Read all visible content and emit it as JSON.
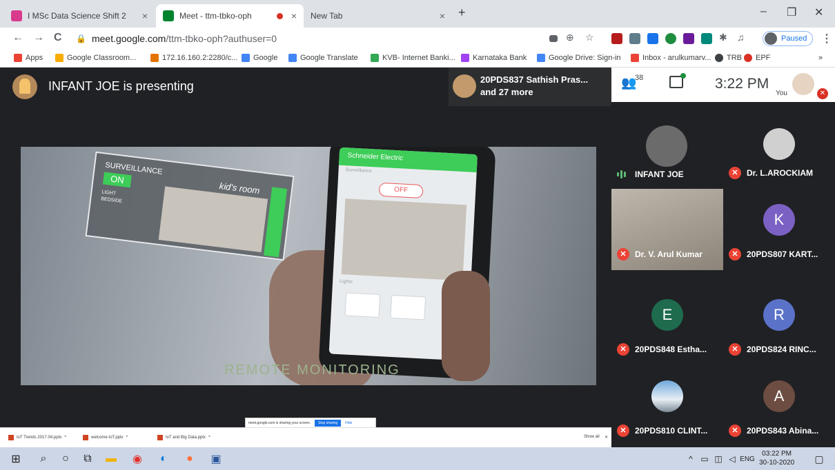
{
  "browser": {
    "tabs": [
      {
        "title": "I MSc Data Science Shift 2",
        "close": "×"
      },
      {
        "title": "Meet - ttm-tbko-oph",
        "close": "×"
      },
      {
        "title": "New Tab",
        "close": "×"
      }
    ],
    "new_tab": "+",
    "window_controls": {
      "minimize": "–",
      "restore": "❐",
      "close": "✕"
    },
    "nav": {
      "back": "←",
      "forward": "→",
      "reload": "C"
    },
    "url_host": "meet.google.com",
    "url_path": "/ttm-tbko-oph?authuser=0",
    "profile_status": "Paused",
    "bookmarks": [
      {
        "label": "Apps",
        "color": "#ea4335"
      },
      {
        "label": "Google Classroom...",
        "color": "#f9ab00"
      },
      {
        "label": "172.16.160.2:2280/c...",
        "color": "#e37400"
      },
      {
        "label": "Google",
        "color": "#4285f4"
      },
      {
        "label": "Google Translate",
        "color": "#4285f4"
      },
      {
        "label": "KVB- Internet Banki...",
        "color": "#34a853"
      },
      {
        "label": "Karnataka Bank",
        "color": "#a142f4"
      },
      {
        "label": "Google Drive: Sign-in",
        "color": "#4285f4"
      },
      {
        "label": "Inbox - arulkumarv...",
        "color": "#ea4335"
      },
      {
        "label": "TRB",
        "color": "#3c4043"
      },
      {
        "label": "EPF",
        "color": "#d93025"
      }
    ],
    "bookmarks_more": "»"
  },
  "meet": {
    "presenting_text": "INFANT JOE is presenting",
    "joined_line1": "20PDS837 Sathish Pras...",
    "joined_line2": "and 27 more",
    "people_count": "38",
    "time": "3:22 PM",
    "you_label": "You",
    "participants": [
      {
        "name": "INFANT JOE",
        "type": "photo",
        "speaking": true
      },
      {
        "name": "Dr. L.AROCKIAM",
        "type": "photo",
        "muted": true
      },
      {
        "name": "Dr. V. Arul Kumar",
        "type": "video",
        "muted": true
      },
      {
        "name": "20PDS807 KART...",
        "initial": "K",
        "color": "#7b61c4",
        "muted": true
      },
      {
        "name": "20PDS848 Estha...",
        "initial": "E",
        "color": "#1e6b4e",
        "muted": true
      },
      {
        "name": "20PDS824 RINC...",
        "initial": "R",
        "color": "#5a72c8",
        "muted": true
      },
      {
        "name": "20PDS810 CLINT...",
        "type": "photo",
        "muted": true
      },
      {
        "name": "20PDS843 Abina...",
        "initial": "A",
        "color": "#6d4c41",
        "muted": true
      }
    ]
  },
  "shared_screen": {
    "popup_title": "SURVEILLANCE",
    "popup_on": "ON",
    "popup_light": "LIGHT",
    "popup_bedside": "BEDSIDE",
    "popup_room": "kid's room",
    "phone_brand": "Schneider Electric",
    "phone_section": "Surveillance",
    "phone_off": "OFF",
    "phone_lights": "Lights",
    "caption": "REMOTE MONITORING",
    "share_notice": "meet.google.com is sharing your screen.",
    "stop_sharing": "Stop sharing",
    "hide": "Hide"
  },
  "downloads": [
    {
      "name": "IoT Trends 2017-04.pptx"
    },
    {
      "name": "welcome-IoT.pptx"
    },
    {
      "name": "IoT and Big Data.pptx"
    }
  ],
  "downloads_show_all": "Show all",
  "taskbar": {
    "lang": "ENG",
    "clock_time": "03:22 PM",
    "clock_date": "30-10-2020"
  }
}
